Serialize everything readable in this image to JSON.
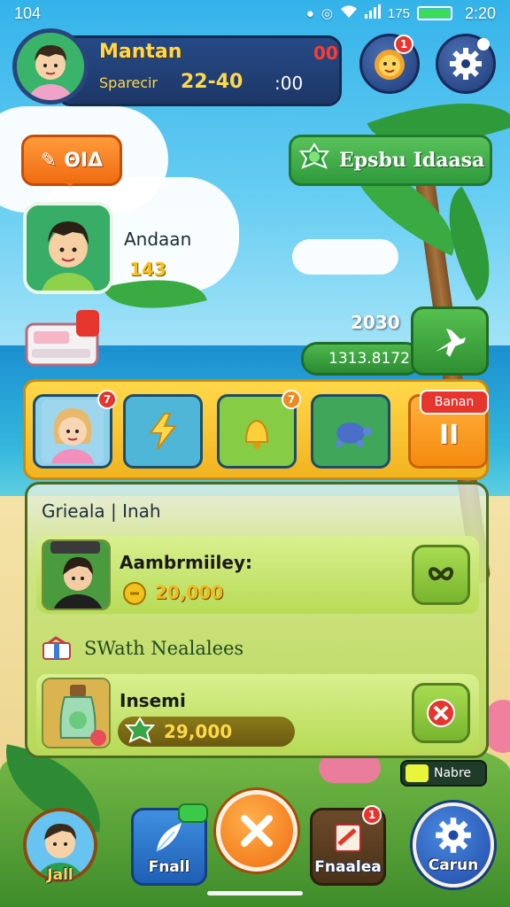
{
  "status_bar": {
    "left": "104",
    "battery": "175",
    "time": "2:20"
  },
  "profile": {
    "name": "Mantan",
    "badge": "00",
    "sub_label": "Sparecir",
    "score": "22-40",
    "timer": ":00"
  },
  "top_buttons": {
    "mascot_badge": "1",
    "settings_badge": ""
  },
  "tag_button": {
    "label": "ΘΙΔ"
  },
  "quest_pill": {
    "label": "Epsbu Idaasa"
  },
  "leader": {
    "name": "Andaan",
    "score": "143"
  },
  "fly": {
    "stat": "2030",
    "pill": "1313.8172"
  },
  "tray": {
    "slots": [
      {
        "name": "character",
        "badge": "7",
        "color": "#7cc7e7"
      },
      {
        "name": "lightning",
        "badge": "",
        "color": "#4fb6d8"
      },
      {
        "name": "bell",
        "badge": "7",
        "color": "#7cc83f"
      },
      {
        "name": "turtle",
        "badge": "",
        "color": "#3fa65a"
      }
    ],
    "shop_label": "Banan",
    "pause_label": "II"
  },
  "panel": {
    "title": "Grieala | Inah",
    "quest1": {
      "name": "Aambrmiiley:",
      "reward": "20,000"
    },
    "section_label": "SWath Nealalees",
    "quest2": {
      "name": "Insemi",
      "reward": "29,000"
    },
    "toggle_label": "Nabre"
  },
  "nav": {
    "profile_label": "Jall",
    "mail_label": "Fnall",
    "center_label": "",
    "quest_label": "Fnaalea",
    "quest_badge": "1",
    "settings_label": "Carun"
  },
  "colors": {
    "accent": "#ffd84a",
    "danger": "#e5352d",
    "primary_green": "#2f9a3c",
    "navy": "#1f3b78"
  }
}
